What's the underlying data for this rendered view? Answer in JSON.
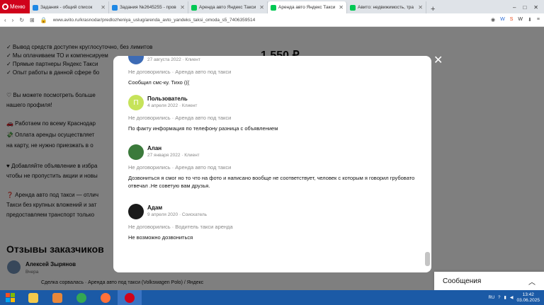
{
  "browser": {
    "menu_label": "Меню",
    "tabs": [
      {
        "title": "Задания - общий список",
        "color": "#1e88e5"
      },
      {
        "title": "Задания №2645255 - пров",
        "color": "#1e88e5"
      },
      {
        "title": "Аренда авто Яндекс Такси",
        "color": "#00c853"
      },
      {
        "title": "Аренда авто Яндекс Такси",
        "color": "#00c853"
      },
      {
        "title": "Авито: недвижимость, тра",
        "color": "#00c853"
      }
    ],
    "url": "www.avito.ru/krasnodar/predlozheniya_uslug/arenda_avto_yandeks_taksi_omoda_s5_7406359514",
    "extensions": [
      "W",
      "S",
      "W"
    ]
  },
  "background": {
    "lines": [
      "✓ Вывод средств доступен круглосуточно, без лимитов",
      "✓ Мы оплачиваем ТО и компенсируем",
      "✓ Прямые партнеры Яндекс Такси",
      "✓ Опыт работы в данной сфере бо",
      "♡ Вы можете посмотреть больше",
      "нашего профиля!",
      "🚗 Работаем по всему Краснодар",
      "💸 Оплата аренды осуществляет",
      "на карту, не нужно приезжать в о",
      "♥ Добавляйте объявление в избра",
      "чтобы не пропустить акции и новы",
      "❓ Аренда авто под такси — отлич",
      "Такси без крупных вложений и зат",
      "предоставляем транспорт только"
    ],
    "price": "1 550 ₽",
    "reviews_title": "Отзывы заказчиков",
    "bg_reviewer_name": "Алексей Зырянов",
    "bg_reviewer_when": "Вчера",
    "bg_review_line": "Сделка сорвалась · Аренда авто под такси (Volkswagen Polo) / Яндекс"
  },
  "modal": {
    "reviews": [
      {
        "name": "",
        "meta": "27 августа 2022 · Клиент",
        "deal": "Не договорились · Аренда авто под такси",
        "text": "Сообщил смс-ку. Тихо (((",
        "avatar_color": "#3d6bb5"
      },
      {
        "name": "Пользователь",
        "meta": "4 апреля 2022 · Клиент",
        "deal": "Не договорились · Аренда авто под такси",
        "text": "По факту информация по телефону разница с объявлением",
        "avatar_color": "#c6e35a",
        "avatar_letter": "П"
      },
      {
        "name": "Алан",
        "meta": "27 января 2022 · Клиент",
        "deal": "Не договорились · Аренда авто под такси",
        "text": "Дозвониться я смог но то что на фото и написано вообще не соответствует, человек с которым я говорил грубовато отвечал .Не советую вам друзья.",
        "avatar_color": "#3b7a3b"
      },
      {
        "name": "Адам",
        "meta": "9 апреля 2020 · Соискатель",
        "deal": "Не договорились · Водитель такси аренда",
        "text": "Не возможно дозвониться",
        "avatar_color": "#1a1a1a"
      }
    ]
  },
  "messages_panel": {
    "label": "Сообщения"
  },
  "taskbar": {
    "lang": "RU",
    "time": "13:42",
    "date": "03.06.2025"
  }
}
